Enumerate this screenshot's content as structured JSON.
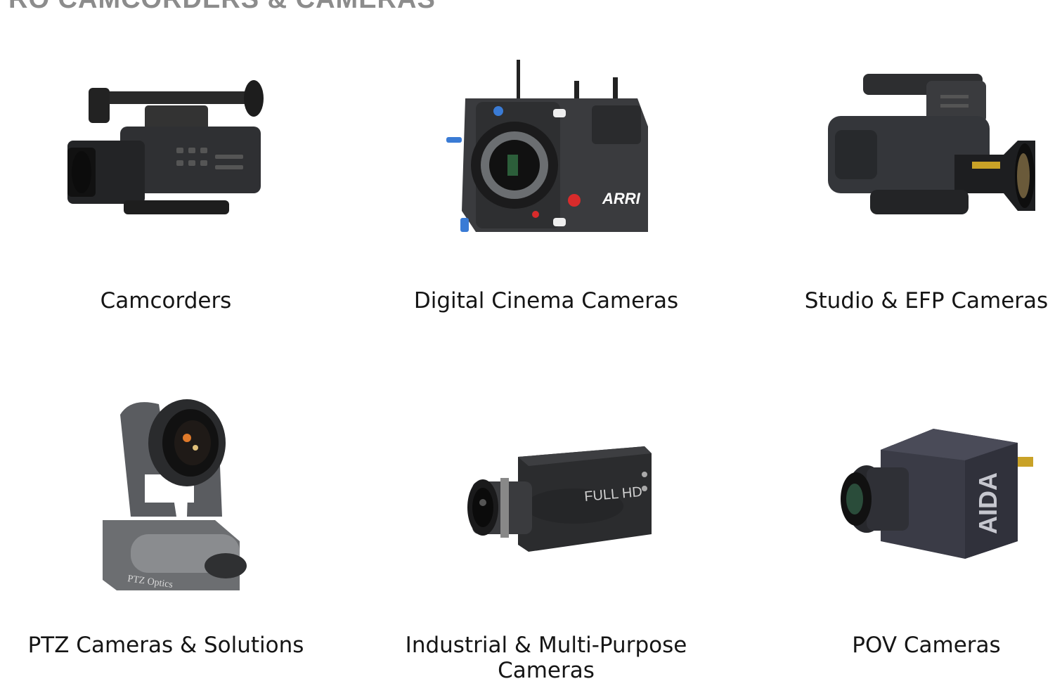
{
  "section": {
    "title": "RO CAMCORDERS & CAMERAS"
  },
  "categories": [
    {
      "label": "Camcorders",
      "icon": "camcorder-image"
    },
    {
      "label": "Digital Cinema Cameras",
      "icon": "cinema-camera-image"
    },
    {
      "label": "Studio & EFP Cameras",
      "icon": "studio-camera-image"
    },
    {
      "label": "PTZ Cameras & Solutions",
      "icon": "ptz-camera-image"
    },
    {
      "label": "Industrial & Multi-Purpose Cameras",
      "icon": "industrial-camera-image"
    },
    {
      "label": "POV Cameras",
      "icon": "pov-camera-image"
    }
  ],
  "product_marks": {
    "cinema_brand": "ARRI",
    "industrial_mark": "FULL HD",
    "ptz_brand": "PTZ Optics",
    "pov_brand": "AIDA"
  },
  "colors": {
    "title": "#8c8c8c",
    "label": "#151515",
    "body_dark": "#2b2c2e",
    "accent_blue": "#3a7bd5",
    "accent_red": "#d92b2b"
  }
}
